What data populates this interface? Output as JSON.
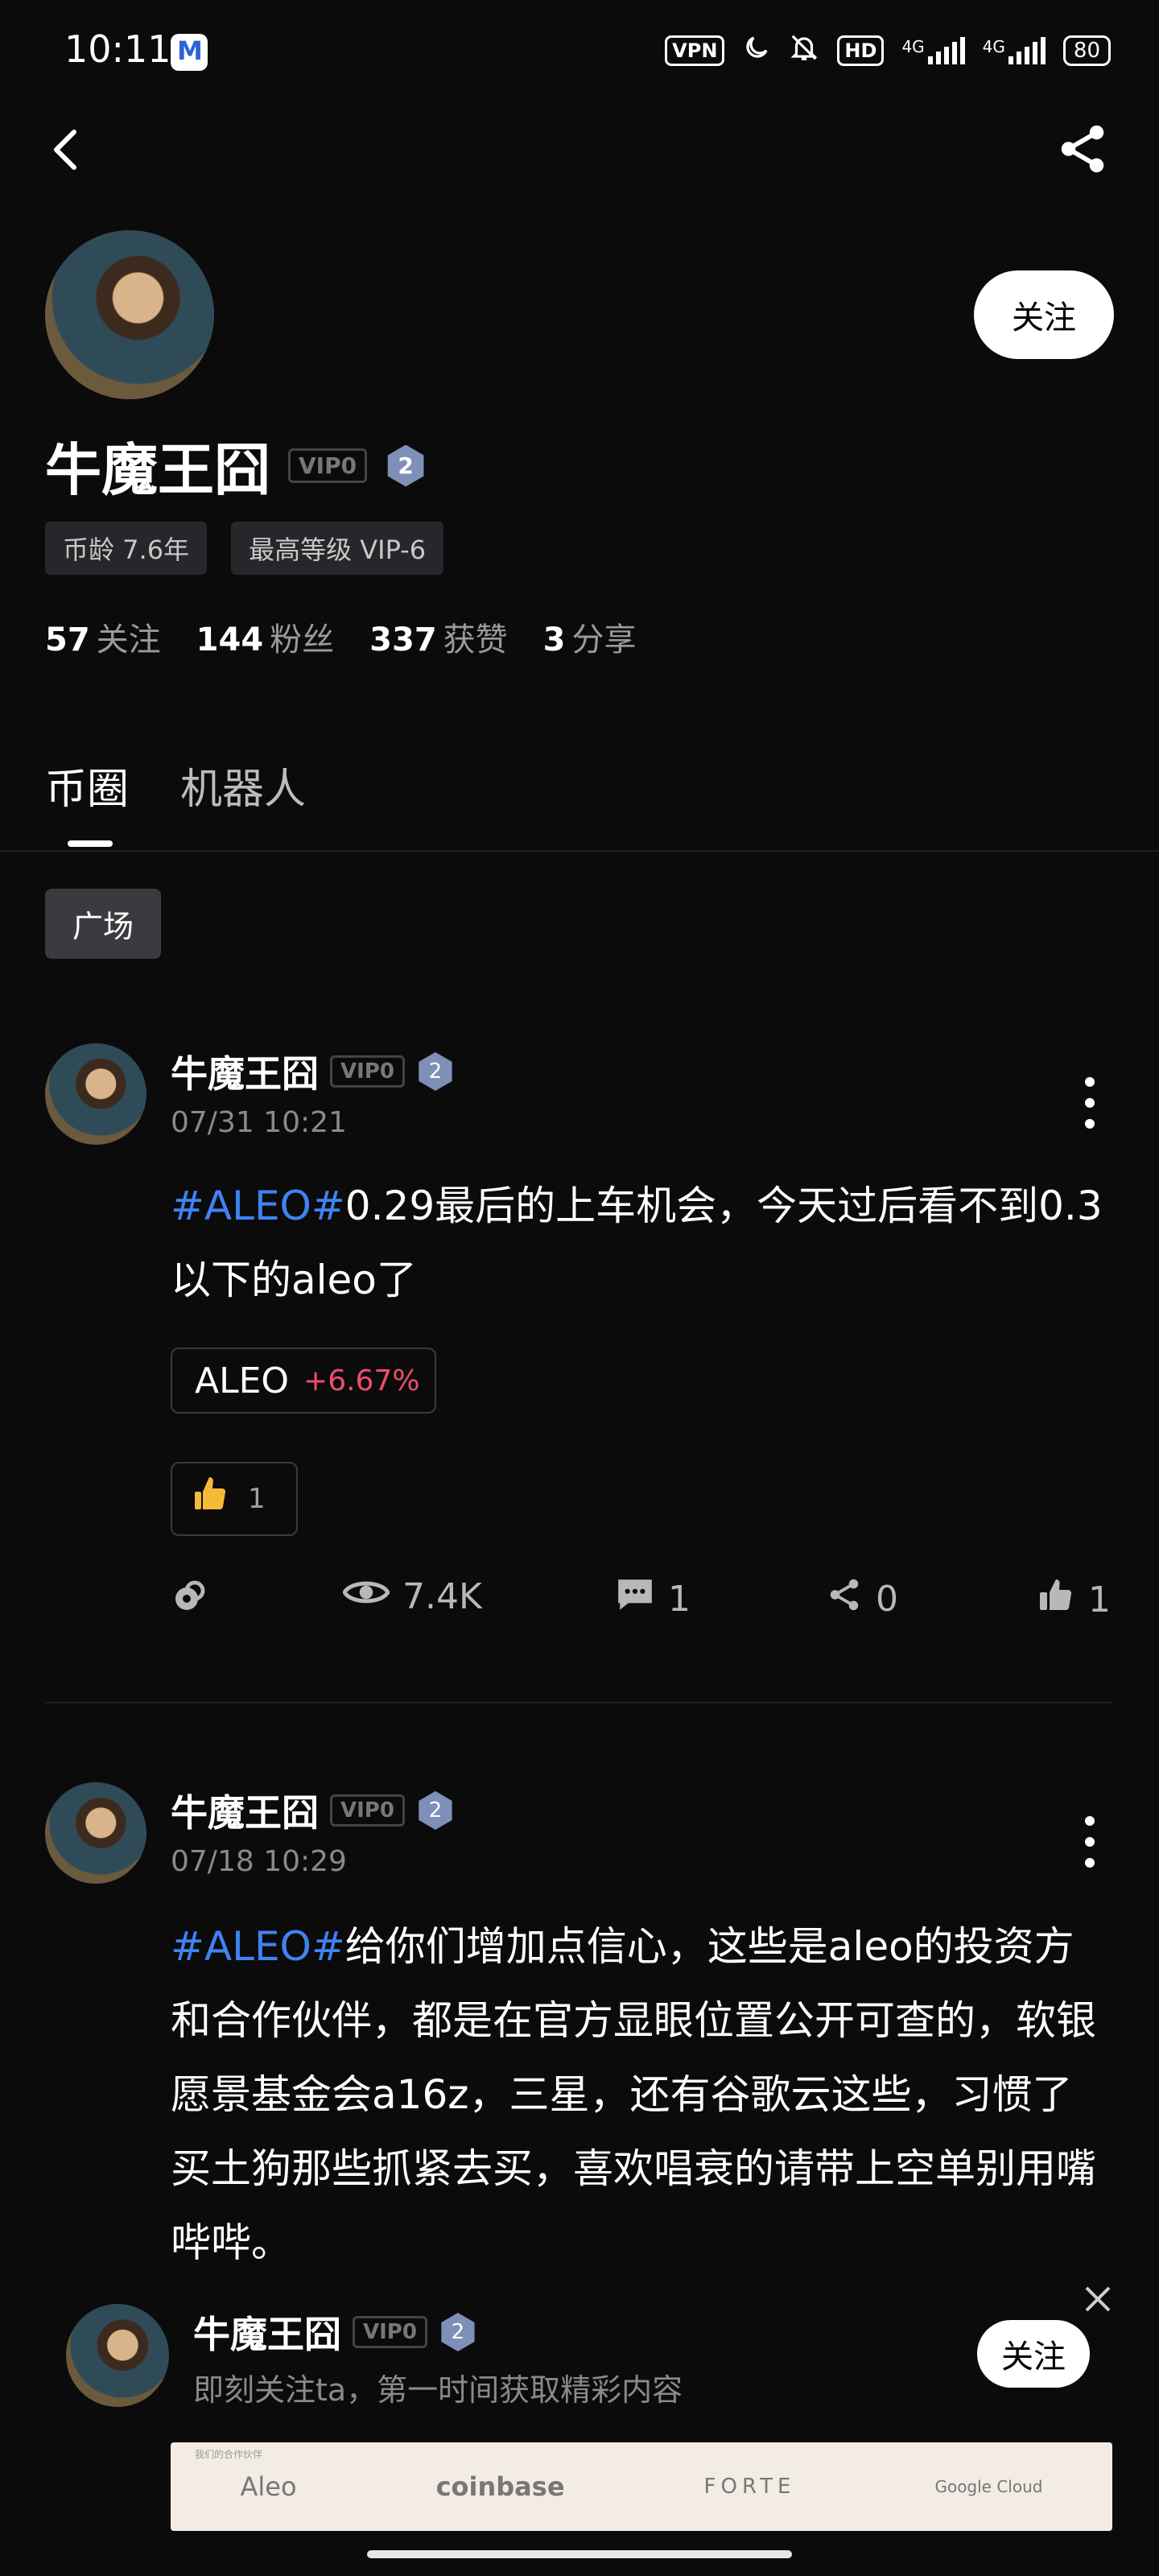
{
  "status_bar": {
    "time": "10:11",
    "vpn": "VPN",
    "hd": "HD",
    "net1": "4G",
    "net2": "4G",
    "battery": "80"
  },
  "profile": {
    "name": "牛魔王囧",
    "vip": "VIP0",
    "level": "2",
    "follow_label": "关注",
    "tags": [
      "币龄 7.6年",
      "最高等级 VIP-6"
    ],
    "stats": [
      {
        "value": "57",
        "label": "关注"
      },
      {
        "value": "144",
        "label": "粉丝"
      },
      {
        "value": "337",
        "label": "获赞"
      },
      {
        "value": "3",
        "label": "分享"
      }
    ]
  },
  "tabs": [
    {
      "label": "币圈",
      "active": true
    },
    {
      "label": "机器人",
      "active": false
    }
  ],
  "filter_chip": "广场",
  "posts": [
    {
      "author": "牛魔王囧",
      "vip": "VIP0",
      "level": "2",
      "date": "07/31 10:21",
      "hashtag": "#ALEO#",
      "text": "0.29最后的上车机会，今天过后看不到0.3以下的aleo了",
      "ticker": {
        "symbol": "ALEO",
        "change": "+6.67%"
      },
      "reaction_count": "1",
      "views": "7.4K",
      "comments": "1",
      "shares": "0",
      "likes": "1"
    },
    {
      "author": "牛魔王囧",
      "vip": "VIP0",
      "level": "2",
      "date": "07/18 10:29",
      "hashtag": "#ALEO#",
      "text": "给你们增加点信心，这些是aleo的投资方和合作伙伴，都是在官方显眼位置公开可查的，软银愿景基金会a16z，三星，还有谷歌云这些，习惯了买土狗那些抓紧去买，喜欢唱衰的请带上空单别用嘴哔哔。"
    }
  ],
  "follow_banner": {
    "name": "牛魔王囧",
    "vip": "VIP0",
    "level": "2",
    "subtitle": "即刻关注ta，第一时间获取精彩内容",
    "follow_label": "关注"
  },
  "partner_image": {
    "caption": "我们的合作伙伴",
    "logos": [
      "Aleo",
      "coinbase",
      "FORTE",
      "Google Cloud"
    ]
  },
  "colors": {
    "background": "#0b0b0c",
    "hashtag": "#3f83f3",
    "price_up": "#ee4d6b"
  }
}
